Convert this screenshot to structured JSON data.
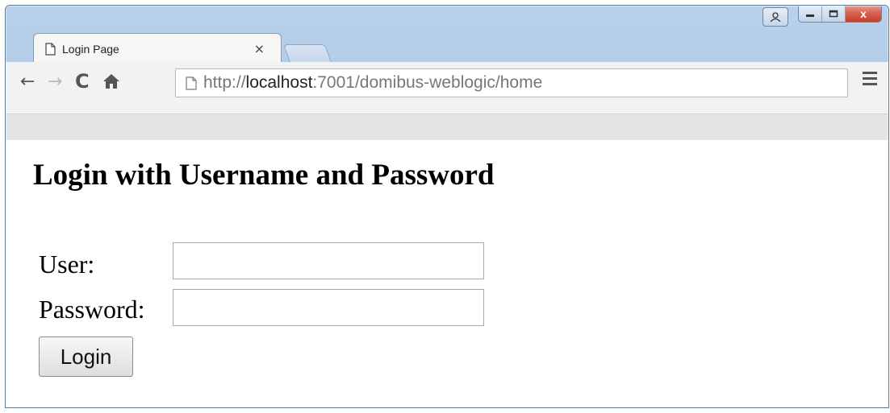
{
  "window": {
    "tab_title": "Login Page",
    "tab_close_glyph": "×",
    "caption_buttons": [
      "minimize-icon",
      "maximize-icon",
      "close-icon"
    ],
    "close_glyph": "x"
  },
  "toolbar": {
    "url_scheme": "http://",
    "url_host": "localhost",
    "url_rest": ":7001/domibus-weblogic/home",
    "icons": [
      "back-arrow-icon",
      "forward-arrow-icon",
      "reload-icon",
      "home-icon",
      "page-icon",
      "menu-icon"
    ]
  },
  "page": {
    "heading": "Login with Username and Password",
    "user_label": "User:",
    "password_label": "Password:",
    "user_value": "",
    "password_value": "",
    "login_button": "Login"
  }
}
